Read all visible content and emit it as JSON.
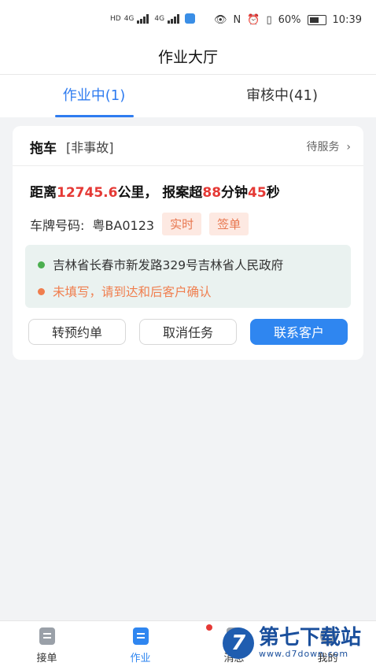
{
  "status_bar": {
    "network_left": "HD",
    "network_type1": "4G",
    "network_type2": "4G",
    "battery": "60%",
    "time": "10:39"
  },
  "header": {
    "title": "作业大厅"
  },
  "tabs": [
    {
      "label": "作业中(1)",
      "active": true
    },
    {
      "label": "审核中(41)",
      "active": false
    }
  ],
  "order": {
    "service_type": "拖车",
    "accident_type": "[非事故]",
    "status": "待服务",
    "distance_prefix": "距离",
    "distance_value": "12745.6",
    "distance_unit": "公里，",
    "overdue_prefix": "报案超",
    "overdue_minutes": "88",
    "minutes_label": "分钟",
    "overdue_seconds": "45",
    "seconds_label": "秒",
    "plate_label": "车牌号码:",
    "plate_number": "粤BA0123",
    "badges": [
      "实时",
      "签单"
    ],
    "address": "吉林省长春市新发路329号吉林省人民政府",
    "destination": "未填写，请到达和后客户确认",
    "buttons": {
      "reschedule": "转预约单",
      "cancel": "取消任务",
      "contact": "联系客户"
    }
  },
  "tabbar": {
    "items": [
      {
        "label": "接单",
        "active": false
      },
      {
        "label": "作业",
        "active": true
      },
      {
        "label": "消息",
        "active": false
      },
      {
        "label": "我的",
        "active": false
      }
    ]
  },
  "watermark": {
    "brand": "第七下载站",
    "url": "www.d7down.com",
    "logo_char": "7"
  },
  "colors": {
    "accent": "#2f86f0",
    "warning_red": "#e53935",
    "badge_orange": "#e8774f",
    "green_dot": "#4caf50",
    "orange_dot": "#f07e4e"
  }
}
